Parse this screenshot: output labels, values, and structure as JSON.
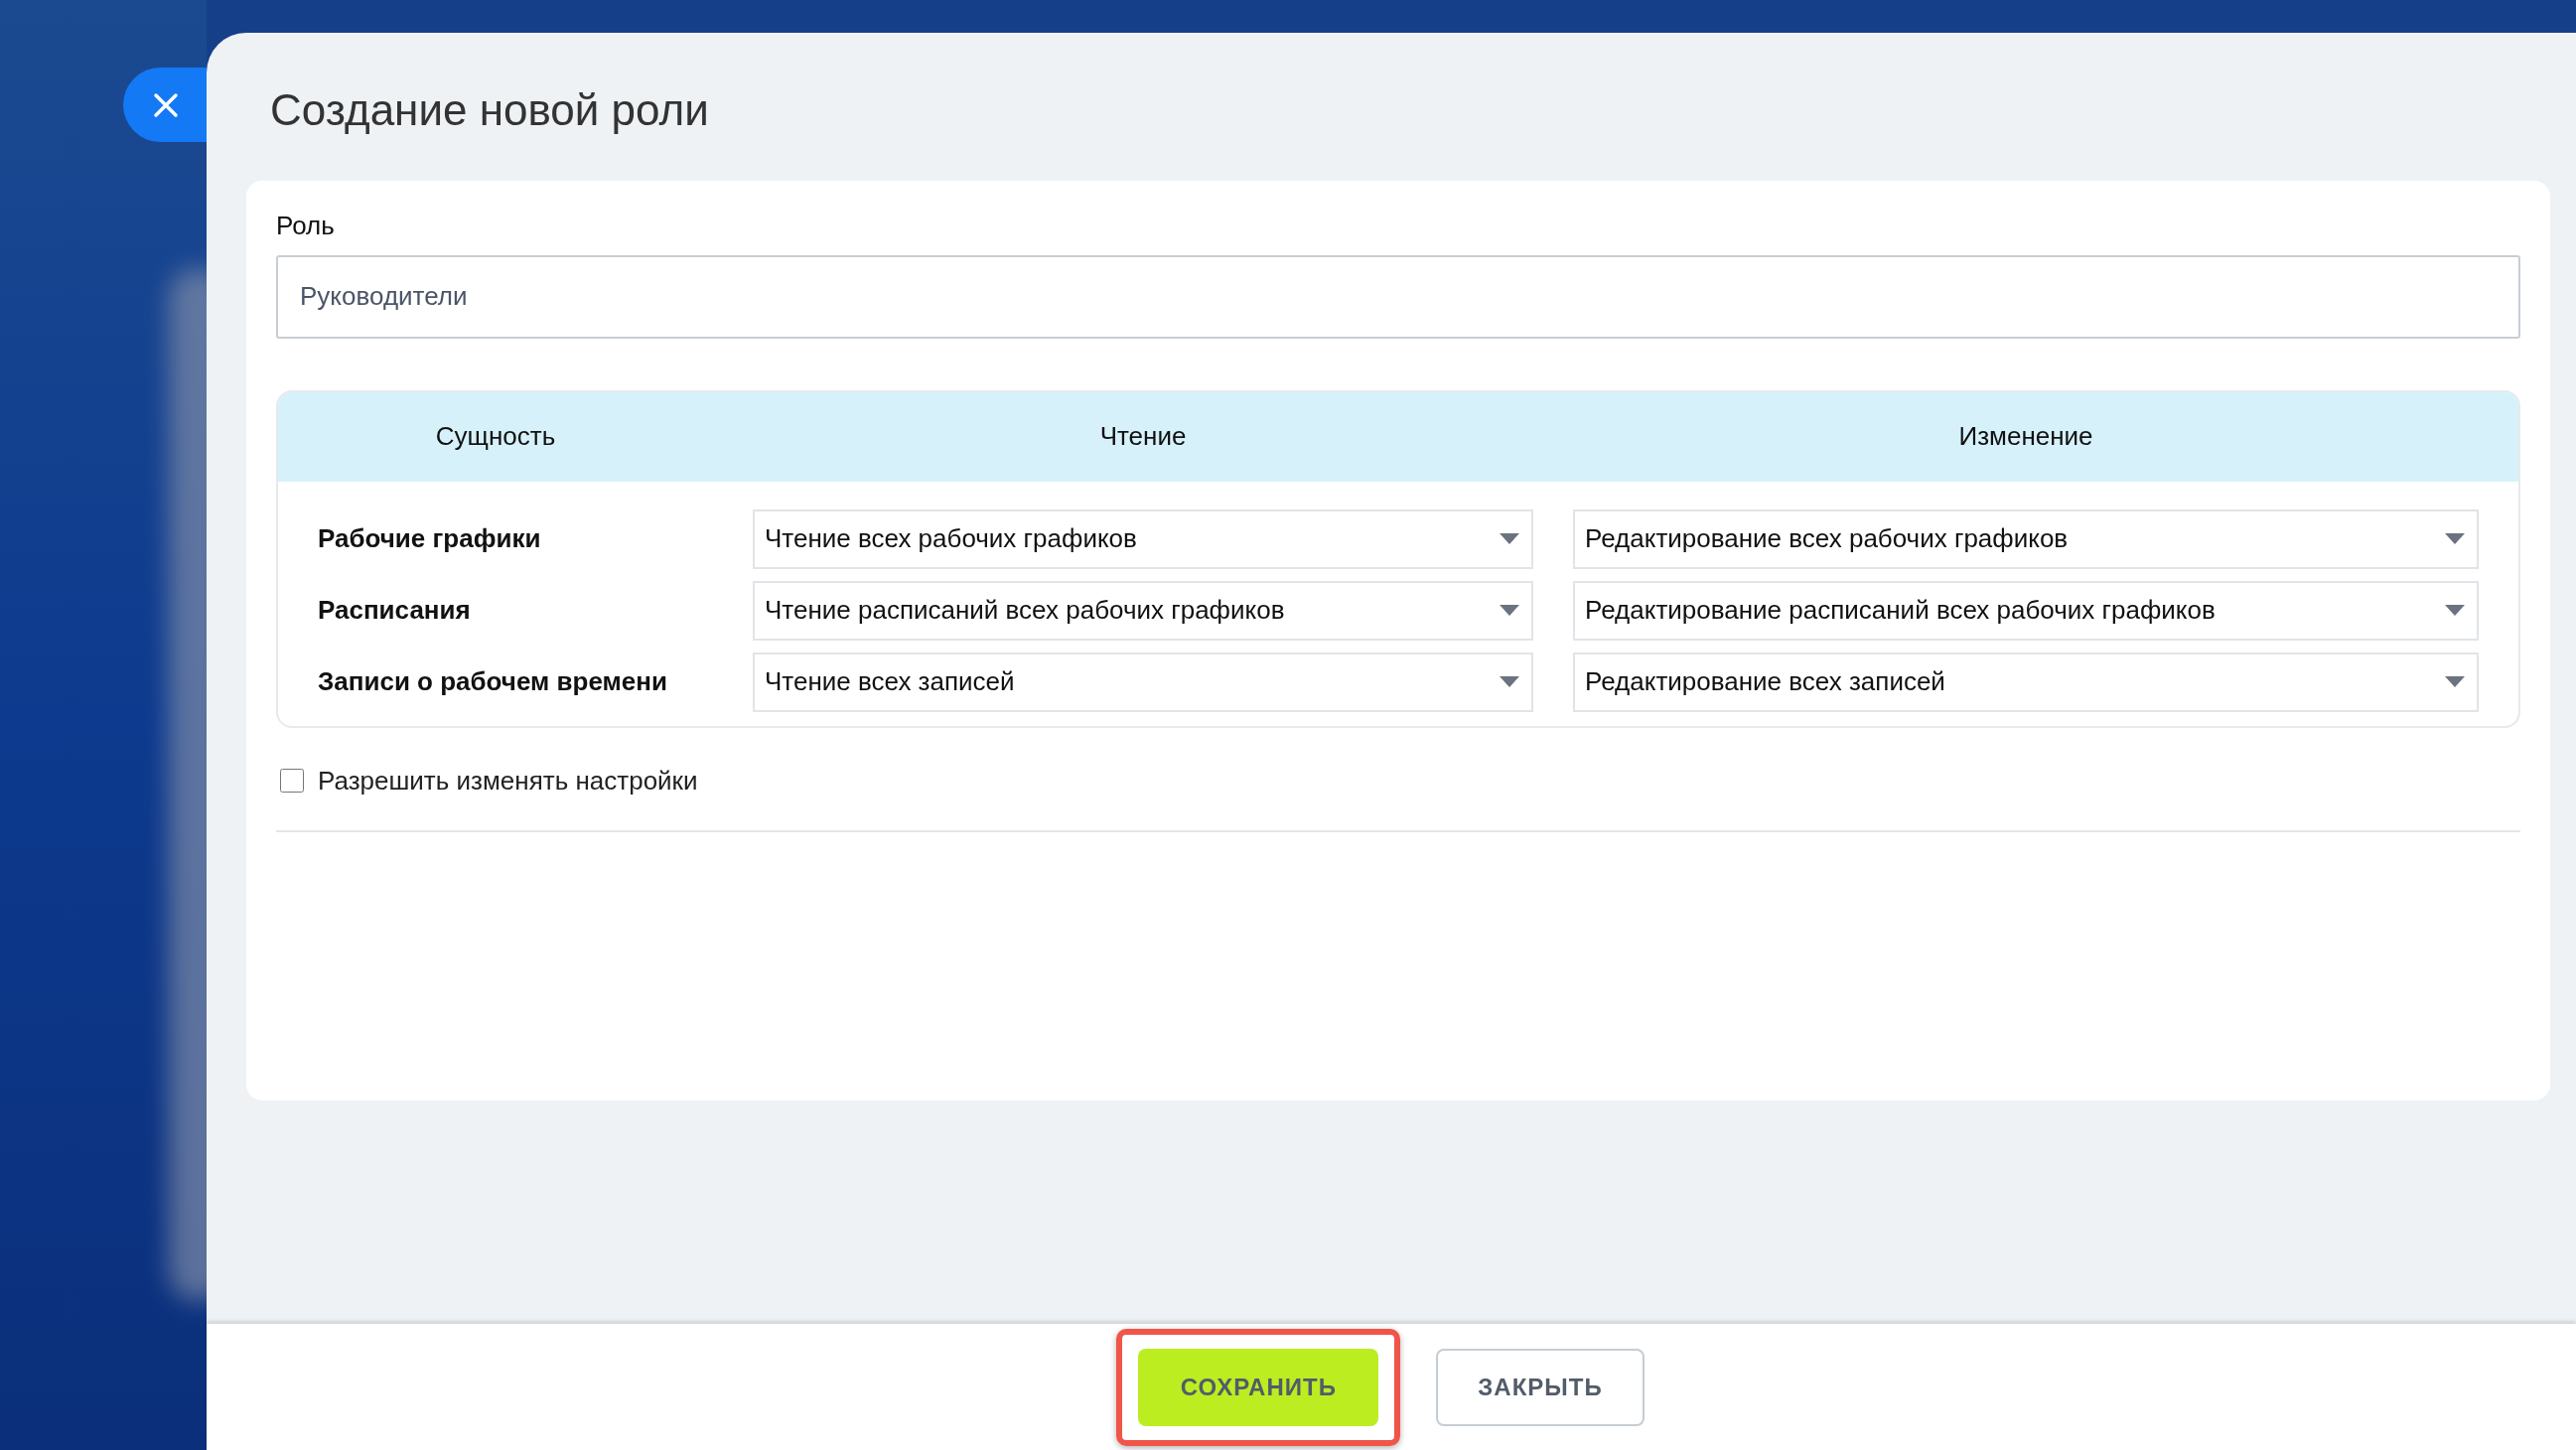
{
  "title": "Создание новой роли",
  "role": {
    "label": "Роль",
    "value": "Руководители"
  },
  "table": {
    "columns": [
      "Сущность",
      "Чтение",
      "Изменение"
    ],
    "rows": [
      {
        "entity": "Рабочие графики",
        "read": "Чтение всех рабочих графиков",
        "edit": "Редактирование всех рабочих графиков"
      },
      {
        "entity": "Расписания",
        "read": "Чтение расписаний всех рабочих графиков",
        "edit": "Редактирование расписаний всех рабочих графиков"
      },
      {
        "entity": "Записи о рабочем времени",
        "read": "Чтение всех записей",
        "edit": "Редактирование всех записей"
      }
    ]
  },
  "allow_settings": {
    "label": "Разрешить изменять настройки",
    "checked": false
  },
  "buttons": [
    {
      "label": "СОХРАНИТЬ",
      "kind": "primary",
      "highlighted": true
    },
    {
      "label": "ЗАКРЫТЬ",
      "kind": "secondary",
      "highlighted": false
    }
  ]
}
